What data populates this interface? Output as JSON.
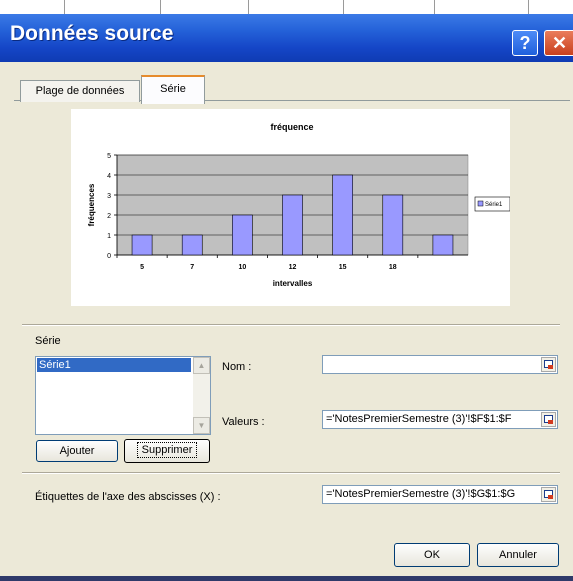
{
  "dialog": {
    "title": "Données source",
    "help_glyph": "?",
    "close_glyph": "✕"
  },
  "tabs": [
    {
      "label": "Plage de données",
      "active": false
    },
    {
      "label": "Série",
      "active": true
    }
  ],
  "chart_data": {
    "type": "bar",
    "title": "fréquence",
    "xlabel": "intervalles",
    "ylabel": "fréquences",
    "categories": [
      "5",
      "7",
      "10",
      "12",
      "15",
      "18",
      ""
    ],
    "series": [
      {
        "name": "Série1",
        "values": [
          1,
          1,
          2,
          3,
          4,
          3,
          1
        ],
        "color": "#9999ff"
      }
    ],
    "ylim": [
      0,
      5
    ],
    "yticks": [
      "0",
      "1",
      "2",
      "3",
      "4",
      "5"
    ],
    "grid": true,
    "plot_background": "#c0c0c0",
    "legend_position": "right"
  },
  "serie_section": {
    "label": "Série",
    "items": [
      "Série1"
    ],
    "selected": "Série1",
    "add_button": "Ajouter",
    "remove_button": "Supprimer",
    "name_label": "Nom :",
    "name_value": "",
    "values_label": "Valeurs :",
    "values_value": "='NotesPremierSemestre (3)'!$F$1:$F",
    "xlabels_label": "Étiquettes de l'axe des abscisses (X) :",
    "xlabels_value": "='NotesPremierSemestre (3)'!$G$1:$G"
  },
  "footer": {
    "ok": "OK",
    "cancel": "Annuler"
  }
}
